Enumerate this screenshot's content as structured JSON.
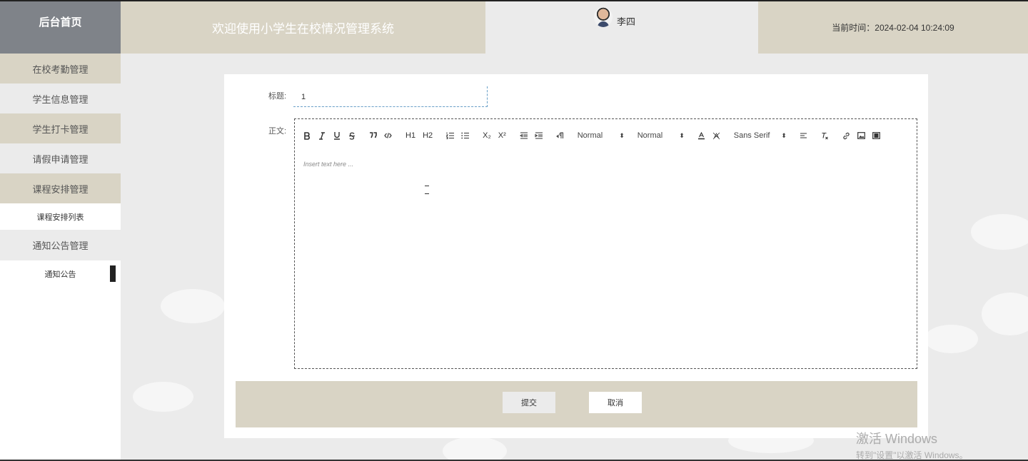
{
  "header": {
    "brand": "后台首页",
    "welcome": "欢迎使用小学生在校情况管理系统",
    "username": "李四",
    "time_label": "当前时间：2024-02-04 10:24:09"
  },
  "sidebar": {
    "items": [
      {
        "label": "在校考勤管理"
      },
      {
        "label": "学生信息管理"
      },
      {
        "label": "学生打卡管理"
      },
      {
        "label": "请假申请管理"
      },
      {
        "label": "课程安排管理"
      },
      {
        "label": "课程安排列表"
      },
      {
        "label": "通知公告管理"
      },
      {
        "label": "通知公告"
      }
    ]
  },
  "form": {
    "title_label": "标题:",
    "title_value": "1",
    "content_label": "正文:",
    "editor_placeholder": "Insert text here ...",
    "toolbar": {
      "h1": "H1",
      "h2": "H2",
      "sub": "X₂",
      "sup": "X²",
      "size_picker": "Normal",
      "header_picker": "Normal",
      "font_picker": "Sans Serif"
    },
    "submit_label": "提交",
    "cancel_label": "取消"
  },
  "watermark": {
    "title": "激活 Windows",
    "subtitle": "转到\"设置\"以激活 Windows。"
  }
}
